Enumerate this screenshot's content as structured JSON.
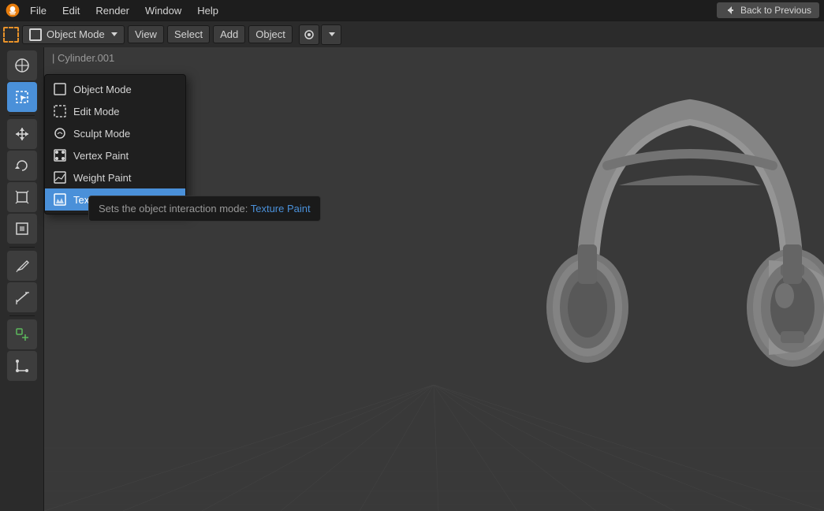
{
  "topbar": {
    "logo": "blender-logo",
    "menus": [
      "File",
      "Edit",
      "Render",
      "Window",
      "Help"
    ],
    "back_button_label": "Back to Previous"
  },
  "header": {
    "mode_label": "Object Mode",
    "view_label": "View",
    "select_label": "Select",
    "add_label": "Add",
    "object_label": "Object"
  },
  "dropdown": {
    "items": [
      {
        "id": "object-mode",
        "label": "Object Mode",
        "icon": "box-icon"
      },
      {
        "id": "edit-mode",
        "label": "Edit Mode",
        "icon": "edit-icon"
      },
      {
        "id": "sculpt-mode",
        "label": "Sculpt Mode",
        "icon": "sculpt-icon"
      },
      {
        "id": "vertex-paint",
        "label": "Vertex Paint",
        "icon": "vertex-icon"
      },
      {
        "id": "weight-paint",
        "label": "Weight Paint",
        "icon": "weight-icon"
      },
      {
        "id": "texture-paint",
        "label": "Texture Paint",
        "icon": "texture-icon",
        "active": true
      }
    ]
  },
  "tooltip": {
    "prefix": "Sets the object interaction mode:",
    "highlight": "Texture Paint"
  },
  "object_name": "| Cylinder.001",
  "sidebar_tools": [
    {
      "id": "cursor",
      "icon": "⊕",
      "active": false
    },
    {
      "id": "select",
      "icon": "◻",
      "active": true
    },
    {
      "id": "move",
      "icon": "✛",
      "active": false
    },
    {
      "id": "rotate",
      "icon": "↻",
      "active": false
    },
    {
      "id": "scale",
      "icon": "⤢",
      "active": false
    },
    {
      "id": "transform",
      "icon": "⧈",
      "active": false
    },
    {
      "id": "pencil",
      "icon": "✏",
      "active": false
    },
    {
      "id": "measure",
      "icon": "📐",
      "active": false
    },
    {
      "id": "add-obj",
      "icon": "⊞",
      "active": false
    },
    {
      "id": "corner",
      "icon": "⌐",
      "active": false
    }
  ]
}
